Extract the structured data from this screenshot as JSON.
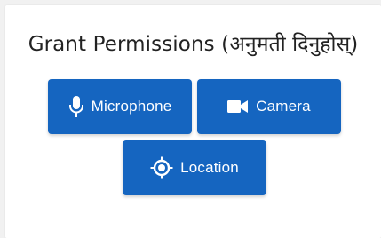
{
  "title": "Grant Permissions (अनुमती दिनुहोस्)",
  "buttons": {
    "microphone": {
      "label": "Microphone",
      "icon": "microphone-icon"
    },
    "camera": {
      "label": "Camera",
      "icon": "camera-icon"
    },
    "location": {
      "label": "Location",
      "icon": "location-target-icon"
    }
  },
  "colors": {
    "button_bg": "#1565c0",
    "button_text": "#ffffff",
    "title_text": "#222222",
    "card_bg": "#ffffff",
    "page_bg": "#f1f1f1"
  }
}
